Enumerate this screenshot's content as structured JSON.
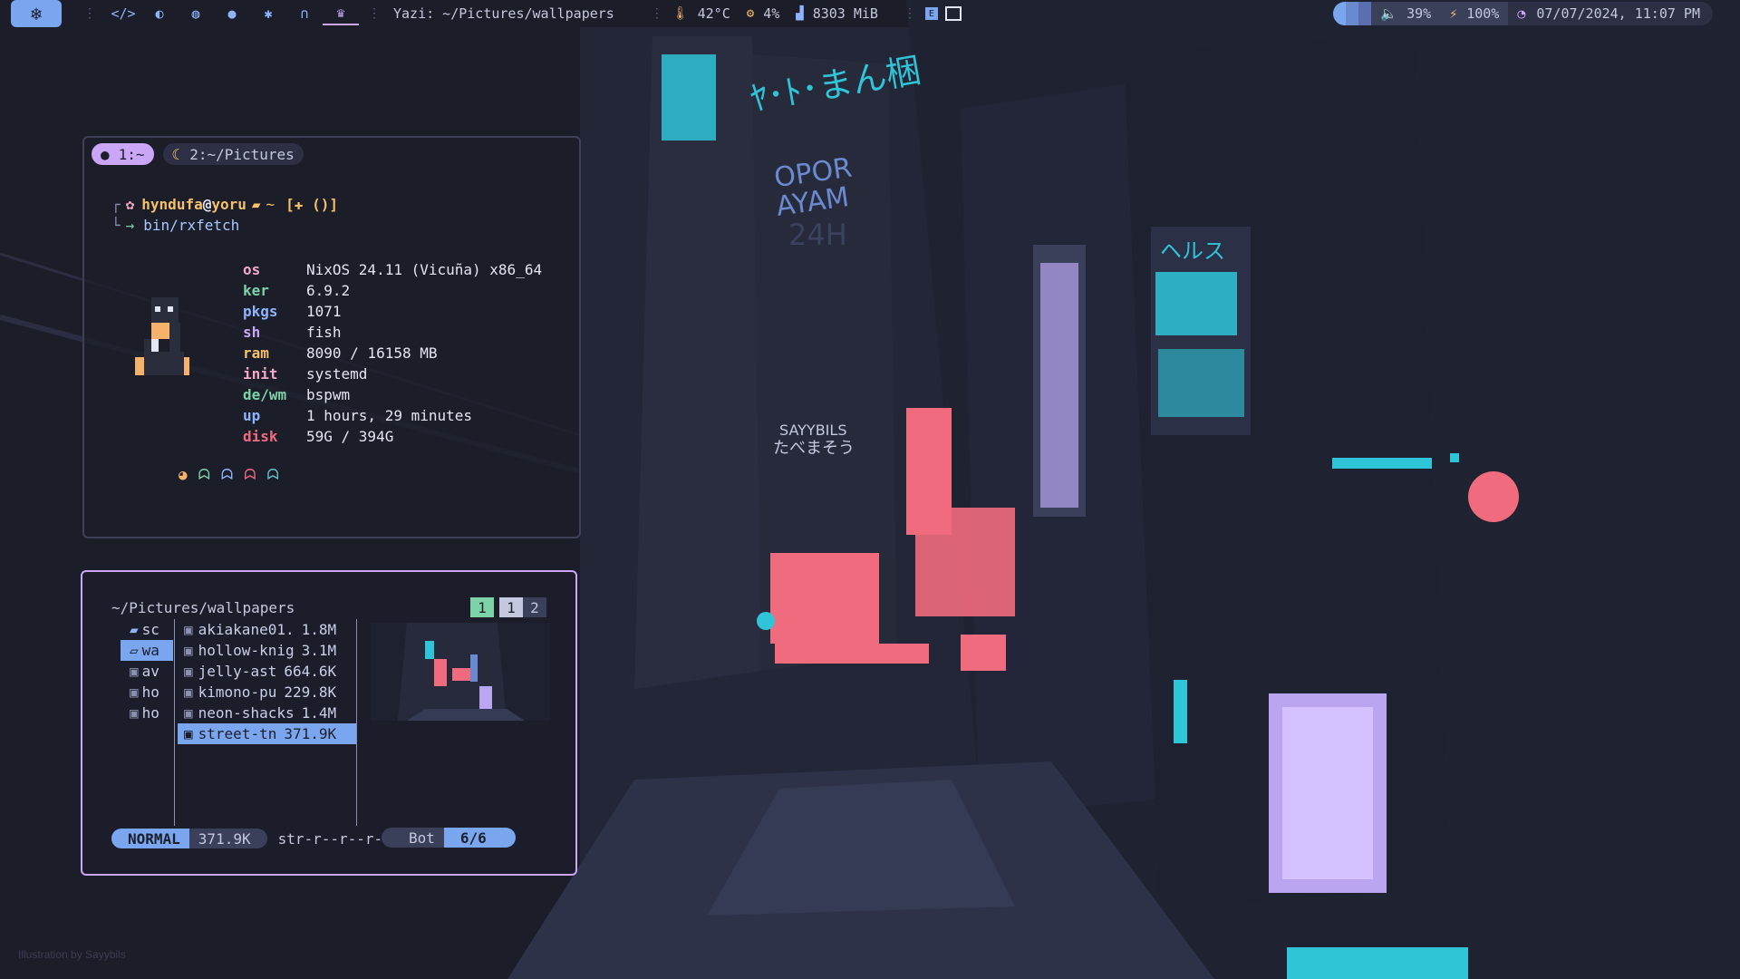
{
  "topbar": {
    "logo_icon": "nixos-snowflake-icon",
    "workspaces": [
      {
        "icon": "code-icon",
        "glyph": "</>"
      },
      {
        "icon": "moon-icon",
        "glyph": "◐"
      },
      {
        "icon": "fire-icon",
        "glyph": "◍"
      },
      {
        "icon": "bomb-icon",
        "glyph": "●"
      },
      {
        "icon": "bug-icon",
        "glyph": "✱"
      },
      {
        "icon": "arch-icon",
        "glyph": "∩"
      },
      {
        "icon": "crown-icon",
        "glyph": "♛"
      }
    ],
    "window_title": "Yazi: ~/Pictures/wallpapers",
    "temperature": "42°C",
    "cpu": "4%",
    "memory": "8303 MiB",
    "volume": "39%",
    "battery": "100%",
    "datetime": "07/07/2024, 11:07 PM",
    "colors": {
      "accent": "#7aa6f0",
      "purple": "#cba6f7"
    }
  },
  "terminal": {
    "tabs": [
      {
        "label": "1:~"
      },
      {
        "label": "2:~/Pictures"
      }
    ],
    "prompt": {
      "user": "hyndufa",
      "host": "yoru",
      "dir": "~",
      "git": "[✚ ()]",
      "command": "bin/rxfetch"
    },
    "fetch": [
      {
        "key": "os",
        "value": "NixOS 24.11 (Vicuña) x86_64"
      },
      {
        "key": "ker",
        "value": "6.9.2"
      },
      {
        "key": "pkgs",
        "value": "1071"
      },
      {
        "key": "sh",
        "value": "fish"
      },
      {
        "key": "ram",
        "value": "8090 / 16158 MB"
      },
      {
        "key": "init",
        "value": "systemd"
      },
      {
        "key": "de/wm",
        "value": "bspwm"
      },
      {
        "key": "up",
        "value": "1 hours, 29 minutes"
      },
      {
        "key": "disk",
        "value": "59G / 394G"
      }
    ]
  },
  "yazi": {
    "path": "~/Pictures/wallpapers",
    "tabs": [
      "1",
      "1",
      "2"
    ],
    "parent_items": [
      "sc",
      "wa",
      "av",
      "ho",
      "ho"
    ],
    "files": [
      {
        "name": "akiakane01.",
        "size": "1.8M"
      },
      {
        "name": "hollow-knig",
        "size": "3.1M"
      },
      {
        "name": "jelly-ast",
        "size": "664.6K"
      },
      {
        "name": "kimono-pu",
        "size": "229.8K"
      },
      {
        "name": "neon-shacks",
        "size": "1.4M"
      },
      {
        "name": "street-tn",
        "size": "371.9K"
      }
    ],
    "status": {
      "mode": "NORMAL",
      "size": "371.9K",
      "perms": "str-r--r--r--",
      "pos_label": "Bot",
      "pos_value": "6/6"
    }
  },
  "credit": "Illustration by Sayybils"
}
